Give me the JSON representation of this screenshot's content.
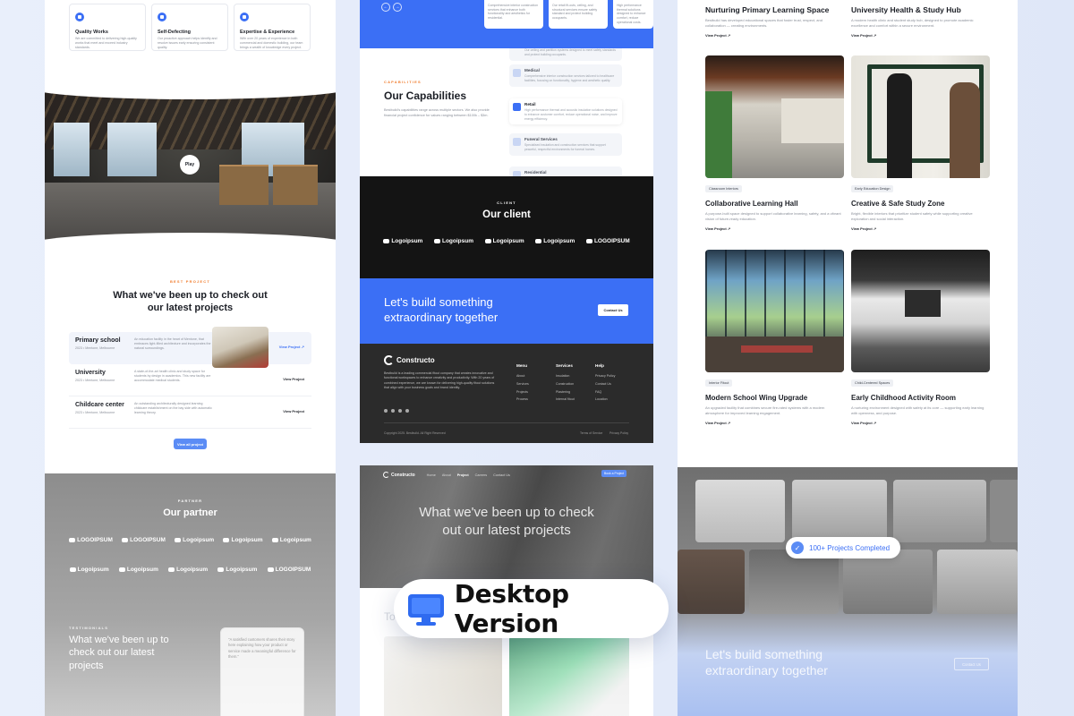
{
  "col1": {
    "features": [
      {
        "title": "Quality Works",
        "desc": "We are committed to delivering high-quality works that meet and exceed industry standards."
      },
      {
        "title": "Self-Defecting",
        "desc": "Our proactive approach helps identify and resolve issues early ensuring consistent quality."
      },
      {
        "title": "Expertise & Experience",
        "desc": "With over 20 years of experience in both commercial and domestic building, our team brings a wealth of knowledge every project."
      }
    ],
    "play_label": "Play",
    "best_project": {
      "eyebrow": "BEST PROJECT",
      "title": "What we've been up to check out our latest projects",
      "items": [
        {
          "name": "Primary school",
          "meta": "2023 • Mentone, Melbourne",
          "desc": "An education facility in the heart of Mentone, that embraces light-filled architecture and incorporates the natural surroundings.",
          "link": "View Project"
        },
        {
          "name": "University",
          "meta": "2023 • Mentone, Melbourne",
          "desc": "A state-of-the-art health clinic and study space for students by design in academics. This new facility are accommodate medical students.",
          "link": "View Project"
        },
        {
          "name": "Childcare center",
          "meta": "2023 • Mentone, Melbourne",
          "desc": "An outstanding architecturally designed learning childcare establishment on the bay side with automatic learning theory.",
          "link": "View Project"
        }
      ],
      "view_all": "View all project"
    },
    "partner": {
      "eyebrow": "PARTNER",
      "title": "Our partner",
      "logos_row1": [
        "LOGOIPSUM",
        "LOGOIPSUM",
        "Logoipsum",
        "Logoipsum",
        "Logoipsum"
      ],
      "logos_row2": [
        "Logoipsum",
        "Logoipsum",
        "Logoipsum",
        "Logoipsum",
        "LOGOIPSUM"
      ],
      "testi_eyebrow": "TESTIMONIALS",
      "testi_title": "What we've been up to check out our latest projects",
      "testi_quote": "\"A satisfied customers shares their story here explaining how your product or service made a meaningful difference for them.\""
    }
  },
  "col2": {
    "mini_cards": [
      "Comprehensive interior construction services that enhance both functionality and aesthetics for residential.",
      "Our retail fit-outs, ceiling, and structural services ensure safety standard and protect building occupants.",
      "High performance thermal solutions designed to enhance comfort, reduce operational costs."
    ],
    "capabilities": {
      "eyebrow": "CAPABILITIES",
      "title": "Our Capabilities",
      "desc": "Bestbuild's capabilities range across multiple sectors. We also provide financial project confidence for values ranging between $100k – $3m.",
      "items": [
        {
          "title": "",
          "desc": "Our ceiling and partition systems designed to meet safety standards and protect building occupants."
        },
        {
          "title": "Medical",
          "desc": "Comprehensive interior construction services tailored to healthcare facilities, focusing on functionality, hygiene and aesthetic quality."
        },
        {
          "title": "Retail",
          "desc": "High performance thermal and acoustic insulation solutions designed to enhance customer comfort, reduce operational noise, and improve energy efficiency."
        },
        {
          "title": "Funeral Services",
          "desc": "Specialised insulation and construction services that support peaceful, respectful environments for funeral homes."
        },
        {
          "title": "Residential",
          "desc": ""
        }
      ]
    },
    "client": {
      "eyebrow": "CLIENT",
      "title": "Our client",
      "logos": [
        "Logoipsum",
        "Logoipsum",
        "Logoipsum",
        "Logoipsum",
        "LOGOIPSUM"
      ]
    },
    "cta": {
      "title": "Let's build something extraordinary together",
      "button": "Contact Us"
    },
    "footer": {
      "brand": "Constructo",
      "desc": "Bestbuild is a leading commercial fitout company that creates innovative and functional workspaces to enhance creativity and productivity. With 20 years of combined experience, we are known for delivering high-quality fitout solutions that align with your business goals and brand identity.",
      "menu_title": "Menu",
      "menu": [
        "About",
        "Services",
        "Projects",
        "Process"
      ],
      "services_title": "Services",
      "services": [
        "Insulation",
        "Construction",
        "Plastering",
        "Internal fitout"
      ],
      "help_title": "Help",
      "help": [
        "Privacy Policy",
        "Contact Us",
        "FAQ",
        "Location"
      ],
      "copyright": "Copyright 2025. Bestbuild. All Right Reserved",
      "terms": "Terms of Service",
      "privacy": "Privacy Policy"
    },
    "hero": {
      "brand": "Constructo",
      "nav": [
        "Home",
        "About",
        "Project",
        "Careers",
        "Contact Us"
      ],
      "nav_current": "Project",
      "book": "Book a Project",
      "title": "What we've been up to check out our latest projects",
      "sub": "To"
    }
  },
  "col3": {
    "top_items": [
      {
        "title": "Nurturing Primary Learning Space",
        "desc": "Bestbuild has developed educational spaces that foster trust, respect, and collaboration — creating environments.",
        "link": "View Project"
      },
      {
        "title": "University Health & Study Hub",
        "desc": "A modern health clinic and student study hub, designed to promote academic excellence and comfort within a secure environment.",
        "link": "View Project"
      }
    ],
    "cards": [
      {
        "tag": "Classroom Interiors",
        "title": "Collaborative Learning Hall",
        "desc": "A purpose-built space designed to support collaborative learning, safety, and a vibrant vision of future-ready education.",
        "link": "View Project"
      },
      {
        "tag": "Early Education Design",
        "title": "Creative & Safe Study Zone",
        "desc": "Bright, flexible interiors that prioritize student safety while supporting creative exploration and social interaction.",
        "link": "View Project"
      },
      {
        "tag": "Interior Fitout",
        "title": "Modern School Wing Upgrade",
        "desc": "An upgraded facility that combines secure fire-rated systems with a modern atmosphere for improved learning engagement.",
        "link": "View Project"
      },
      {
        "tag": "Child-Centered Spaces",
        "title": "Early Childhood Activity Room",
        "desc": "A nurturing environment designed with safety at its core — supporting early learning with openness, and purpose.",
        "link": "View Project"
      }
    ],
    "projects_pill": "100+ Projects Completed",
    "cta_title": "Let's build something extraordinary together",
    "cta_button": "Contact Us"
  },
  "badge": {
    "label": "Desktop Version",
    "icon": "monitor-icon"
  }
}
